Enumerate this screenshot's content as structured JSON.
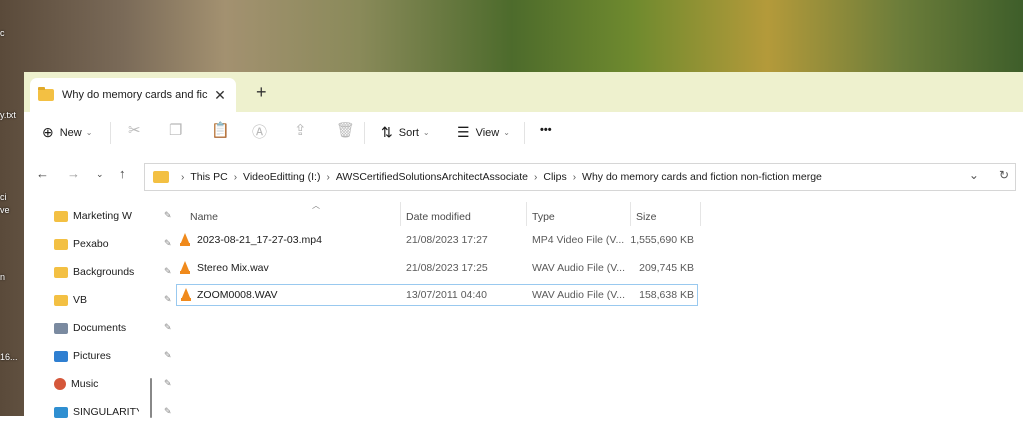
{
  "desktop": {
    "labels": [
      "c",
      "y.txt",
      "ci",
      "ve",
      "n",
      "16..."
    ]
  },
  "tab": {
    "title": "Why do memory cards and fic"
  },
  "toolbar": {
    "new_label": "New",
    "sort_label": "Sort",
    "view_label": "View",
    "more_label": "•••"
  },
  "address": {
    "crumbs": [
      "This PC",
      "VideoEditting (I:)",
      "AWSCertifiedSolutionsArchitectAssociate",
      "Clips",
      "Why do memory cards and fiction non-fiction merge"
    ]
  },
  "sidebar": {
    "items": [
      {
        "label": "Marketing W",
        "icon": "folder-icon",
        "color": "#f3c043"
      },
      {
        "label": "Pexabo",
        "icon": "folder-icon",
        "color": "#f3c043"
      },
      {
        "label": "Backgrounds",
        "icon": "folder-icon",
        "color": "#f3c043"
      },
      {
        "label": "VB",
        "icon": "folder-icon",
        "color": "#f3c043"
      },
      {
        "label": "Documents",
        "icon": "documents-icon",
        "color": "#7a8aa0"
      },
      {
        "label": "Pictures",
        "icon": "pictures-icon",
        "color": "#2f7fd1"
      },
      {
        "label": "Music",
        "icon": "music-icon",
        "color": "#d5573a"
      },
      {
        "label": "SINGULARITY",
        "icon": "folder-icon",
        "color": "#2f8fd1"
      }
    ]
  },
  "columns": {
    "name": "Name",
    "date": "Date modified",
    "type": "Type",
    "size": "Size"
  },
  "files": [
    {
      "name": "2023-08-21_17-27-03.mp4",
      "date": "21/08/2023 17:27",
      "type": "MP4 Video File (V...",
      "size": "1,555,690 KB"
    },
    {
      "name": "Stereo Mix.wav",
      "date": "21/08/2023 17:25",
      "type": "WAV Audio File (V...",
      "size": "209,745 KB"
    },
    {
      "name": "ZOOM0008.WAV",
      "date": "13/07/2011 04:40",
      "type": "WAV Audio File (V...",
      "size": "158,638 KB"
    }
  ]
}
